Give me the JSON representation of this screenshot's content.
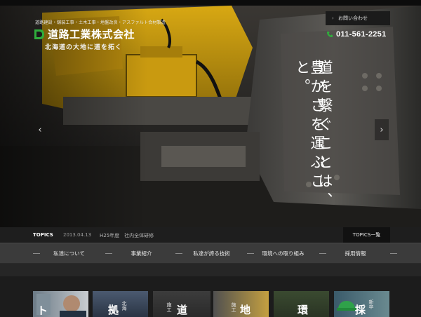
{
  "header": {
    "tagline": "道路建設・舗装工事・土木工事・地盤改良・アスファルト合材製造",
    "company_name": "道路工業株式会社",
    "slogan": "北海道の大地に道を拓く",
    "contact_label": "お問い合わせ",
    "phone": "011-561-2251",
    "brand_color": "#2fae3c"
  },
  "hero": {
    "line1": "道を繋ぐことは、",
    "line2": "豊かさを運ぶこと。",
    "prev_icon": "chevron-left-icon",
    "next_icon": "chevron-right-icon"
  },
  "topics": {
    "label": "TOPICS",
    "date": "2013.04.13",
    "title": "H25年度　社内全体研修",
    "list_button": "TOPICS一覧"
  },
  "nav": {
    "items": [
      {
        "label": "私達について"
      },
      {
        "label": "事業紹介"
      },
      {
        "label": "私達が誇る技術"
      },
      {
        "label": "環境への取り組み"
      },
      {
        "label": "採用情報"
      }
    ]
  },
  "cards": [
    {
      "title": "ト",
      "small": ""
    },
    {
      "title": "拠",
      "small": "北海"
    },
    {
      "title": "",
      "small": "施工"
    },
    {
      "title": "道",
      "small": "施工"
    },
    {
      "title": "地",
      "small": "施工"
    },
    {
      "title": "環",
      "small": ""
    },
    {
      "title": "採",
      "small": "新卒"
    }
  ]
}
